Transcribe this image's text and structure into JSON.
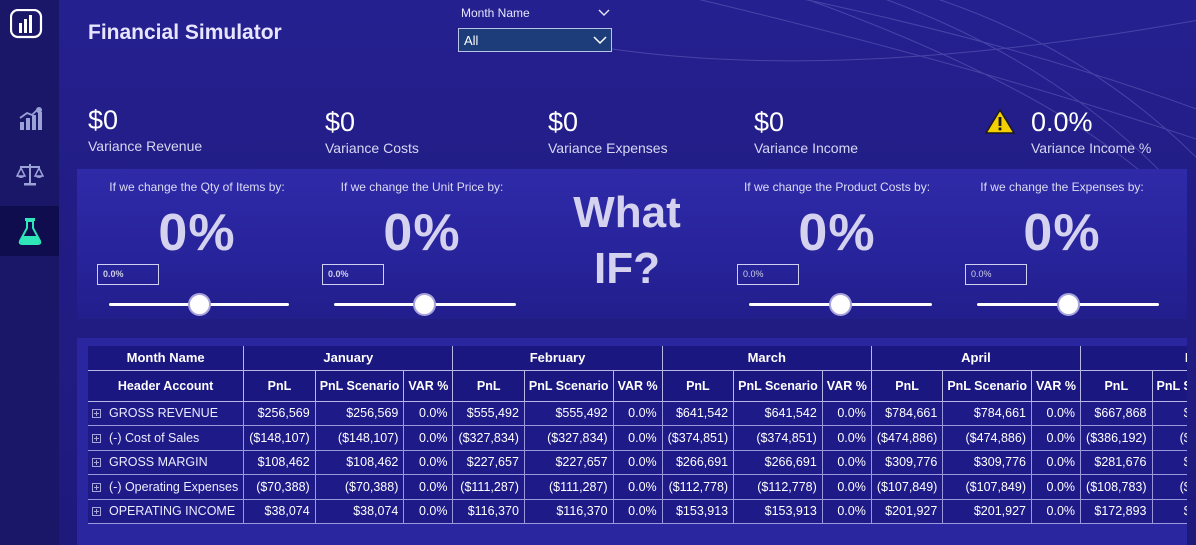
{
  "nav": {
    "items": [
      {
        "name": "report-icon"
      },
      {
        "name": "chart-icon"
      },
      {
        "name": "scales-icon"
      },
      {
        "name": "flask-icon",
        "active": true
      }
    ]
  },
  "header": {
    "title": "Financial Simulator"
  },
  "slicer": {
    "label": "Month Name",
    "value": "All"
  },
  "kpis": [
    {
      "value": "$0",
      "label": "Variance Revenue"
    },
    {
      "value": "$0",
      "label": "Variance Costs"
    },
    {
      "value": "$0",
      "label": "Variance Expenses"
    },
    {
      "value": "$0",
      "label": "Variance Income"
    },
    {
      "value": "0.0%",
      "label": "Variance Income %",
      "icon": "warning-icon",
      "icon_color": "#f5d000"
    }
  ],
  "whatif": {
    "title_line1": "What",
    "title_line2": "IF?",
    "controls": [
      {
        "caption": "If we change the Qty of Items by:",
        "value": "0%",
        "input": "0.0%",
        "slider_level": 0.5
      },
      {
        "caption": "If we change the Unit Price by:",
        "value": "0%",
        "input": "0.0%",
        "slider_level": 0.5
      },
      {
        "caption": "If we change the Product Costs by:",
        "value": "0%",
        "input": "0.0%",
        "slider_level": 0.5
      },
      {
        "caption": "If we change the Expenses by:",
        "value": "0%",
        "input": "0.0%",
        "slider_level": 0.5
      }
    ]
  },
  "table": {
    "row_header_1": "Month Name",
    "row_header_2": "Header Account",
    "months": [
      "January",
      "February",
      "March",
      "April",
      "M"
    ],
    "sub_headers": [
      "PnL",
      "PnL Scenario",
      "VAR %"
    ],
    "last_sub_headers": [
      "PnL",
      "PnL S"
    ],
    "rows": [
      {
        "account": "GROSS REVENUE",
        "cells": [
          "$256,569",
          "$256,569",
          "0.0%",
          "$555,492",
          "$555,492",
          "0.0%",
          "$641,542",
          "$641,542",
          "0.0%",
          "$784,661",
          "$784,661",
          "0.0%",
          "$667,868",
          "$"
        ]
      },
      {
        "account": "(-) Cost of Sales",
        "cells": [
          "($148,107)",
          "($148,107)",
          "0.0%",
          "($327,834)",
          "($327,834)",
          "0.0%",
          "($374,851)",
          "($374,851)",
          "0.0%",
          "($474,886)",
          "($474,886)",
          "0.0%",
          "($386,192)",
          "($"
        ]
      },
      {
        "account": "GROSS MARGIN",
        "cells": [
          "$108,462",
          "$108,462",
          "0.0%",
          "$227,657",
          "$227,657",
          "0.0%",
          "$266,691",
          "$266,691",
          "0.0%",
          "$309,776",
          "$309,776",
          "0.0%",
          "$281,676",
          "$"
        ]
      },
      {
        "account": "(-) Operating Expenses",
        "cells": [
          "($70,388)",
          "($70,388)",
          "0.0%",
          "($111,287)",
          "($111,287)",
          "0.0%",
          "($112,778)",
          "($112,778)",
          "0.0%",
          "($107,849)",
          "($107,849)",
          "0.0%",
          "($108,783)",
          "($"
        ]
      },
      {
        "account": "OPERATING INCOME",
        "cells": [
          "$38,074",
          "$38,074",
          "0.0%",
          "$116,370",
          "$116,370",
          "0.0%",
          "$153,913",
          "$153,913",
          "0.0%",
          "$201,927",
          "$201,927",
          "0.0%",
          "$172,893",
          "$"
        ]
      }
    ]
  }
}
